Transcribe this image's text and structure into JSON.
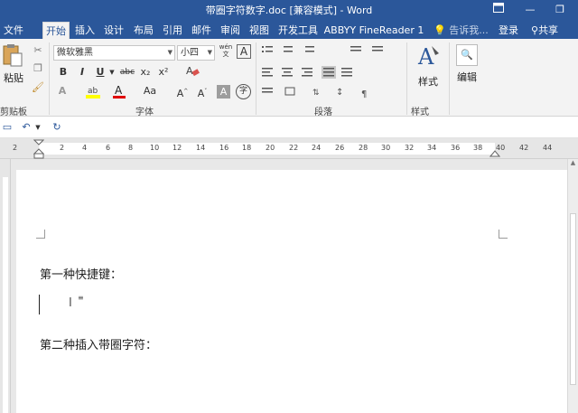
{
  "title_bar": {
    "title": "带圈字符数字.doc [兼容模式] - Word",
    "restore_icon": "ribbon-display-icon",
    "minimize": "—",
    "restore": "❐"
  },
  "tabs": [
    {
      "label": "文件"
    },
    {
      "label": "开始"
    },
    {
      "label": "插入"
    },
    {
      "label": "设计"
    },
    {
      "label": "布局"
    },
    {
      "label": "引用"
    },
    {
      "label": "邮件"
    },
    {
      "label": "审阅"
    },
    {
      "label": "视图"
    },
    {
      "label": "开发工具"
    },
    {
      "label": "ABBYY FineReader 1"
    }
  ],
  "tell_me": "告诉我...",
  "login": "登录",
  "share": "共享",
  "ribbon": {
    "clipboard": {
      "paste": "粘贴",
      "label": "剪贴板"
    },
    "font": {
      "font_name": "微软雅黑",
      "font_size": "小四",
      "wen_label": "wén\n文",
      "bold": "B",
      "italic": "I",
      "underline": "U",
      "strike": "abc",
      "subscript": "x₂",
      "superscript": "x²",
      "grow": "A^",
      "shrink": "A˅",
      "change_case": "Aa",
      "clear": "A",
      "char_shade": "A",
      "enclose": "字",
      "label": "字体"
    },
    "paragraph": {
      "label": "段落"
    },
    "styles": {
      "button": "样式",
      "label": "样式"
    },
    "editing": {
      "button": "编辑"
    }
  },
  "ruler_numbers": [
    "2",
    "2",
    "4",
    "6",
    "8",
    "10",
    "12",
    "14",
    "16",
    "18",
    "20",
    "22",
    "24",
    "26",
    "28",
    "30",
    "32",
    "34",
    "36",
    "38",
    "40",
    "42",
    "44"
  ],
  "document": {
    "line1": "第一种快捷键：",
    "line2": "第二种插入带圈字符："
  },
  "colors": {
    "word_blue": "#2b579a",
    "highlight_yellow": "#ffff00",
    "font_red": "#e00000"
  }
}
